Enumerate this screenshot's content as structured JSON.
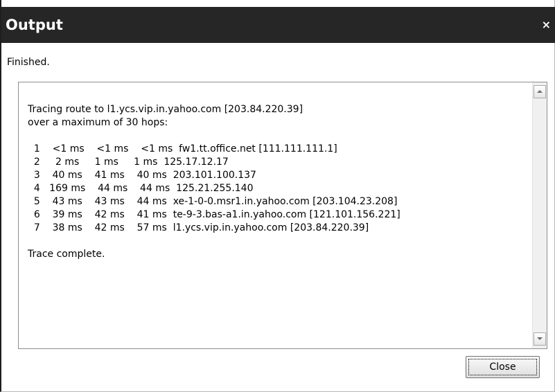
{
  "window": {
    "title": "Output",
    "close_glyph": "×"
  },
  "status": "Finished.",
  "output": {
    "text": "Tracing route to l1.ycs.vip.in.yahoo.com [203.84.220.39]\nover a maximum of 30 hops:\n\n  1    <1 ms    <1 ms    <1 ms  fw1.tt.office.net [111.111.111.1]\n  2     2 ms     1 ms     1 ms  125.17.12.17\n  3    40 ms    41 ms    40 ms  203.101.100.137\n  4   169 ms    44 ms    44 ms  125.21.255.140\n  5    43 ms    43 ms    44 ms  xe-1-0-0.msr1.in.yahoo.com [203.104.23.208]\n  6    39 ms    42 ms    41 ms  te-9-3.bas-a1.in.yahoo.com [121.101.156.221]\n  7    38 ms    42 ms    57 ms  l1.ycs.vip.in.yahoo.com [203.84.220.39]\n\nTrace complete."
  },
  "buttons": {
    "close_label": "Close"
  },
  "icons": {
    "scroll_up": "scroll-up-arrow-icon",
    "scroll_down": "scroll-down-arrow-icon"
  },
  "colors": {
    "titlebar": "#262626",
    "title_text": "#ffffff"
  }
}
